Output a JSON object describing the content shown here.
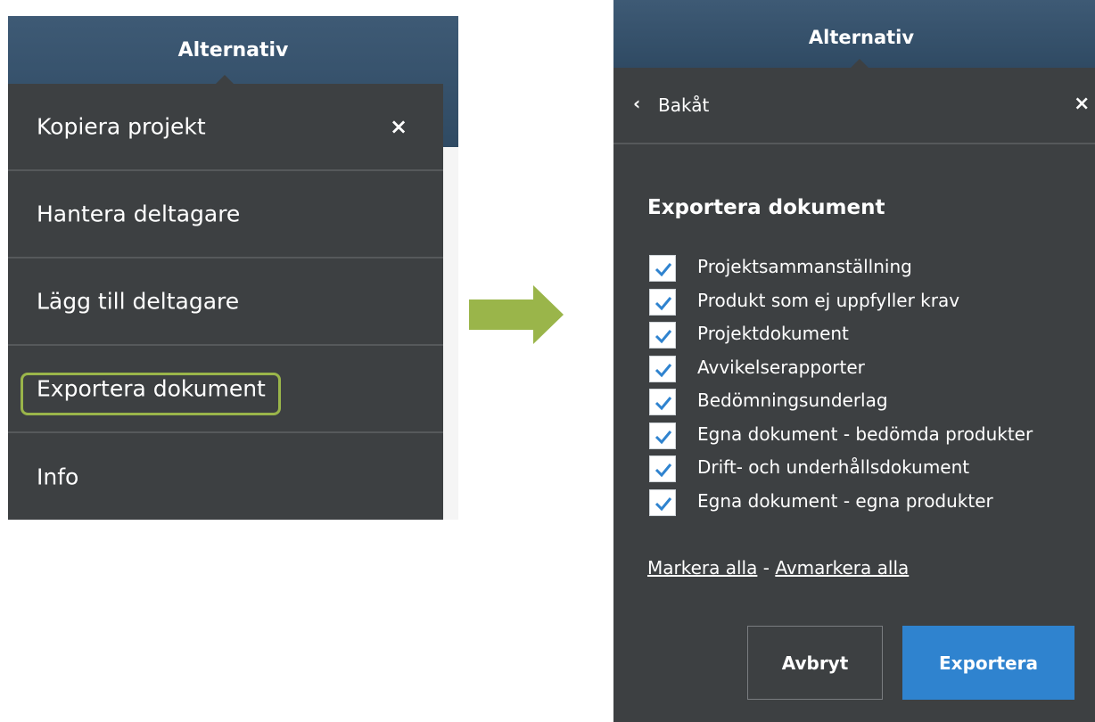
{
  "left_panel": {
    "header_title": "Alternativ",
    "menu_items": [
      {
        "label": "Kopiera projekt"
      },
      {
        "label": "Hantera deltagare"
      },
      {
        "label": "Lägg till deltagare"
      },
      {
        "label": "Exportera dokument"
      },
      {
        "label": "Info"
      }
    ],
    "close_glyph": "×"
  },
  "right_panel": {
    "header_title": "Alternativ",
    "back_label": "Bakåt",
    "back_icon": "‹",
    "close_glyph": "×",
    "section_title": "Exportera dokument",
    "checkbox_items": [
      {
        "label": "Projektsammanställning",
        "checked": true
      },
      {
        "label": "Produkt som ej uppfyller krav",
        "checked": true
      },
      {
        "label": "Projektdokument",
        "checked": true
      },
      {
        "label": "Avvikelserapporter",
        "checked": true
      },
      {
        "label": "Bedömningsunderlag",
        "checked": true
      },
      {
        "label": "Egna dokument - bedömda produkter",
        "checked": true
      },
      {
        "label": "Drift- och underhållsdokument",
        "checked": true
      },
      {
        "label": "Egna dokument - egna produkter",
        "checked": true
      }
    ],
    "select_all_label": "Markera alla",
    "separator": " - ",
    "deselect_all_label": "Avmarkera alla",
    "cancel_label": "Avbryt",
    "export_label": "Exportera"
  },
  "colors": {
    "header_blue": "#355069",
    "panel_dark": "#3d4042",
    "highlight_green": "#9ab54a",
    "check_blue": "#2f83cf",
    "export_button": "#2f83cf",
    "arrow_green": "#9ab54a"
  },
  "icons": {
    "arrow": "arrow-right-icon",
    "check": "checkmark-icon",
    "close": "close-icon",
    "back": "chevron-left-icon"
  }
}
